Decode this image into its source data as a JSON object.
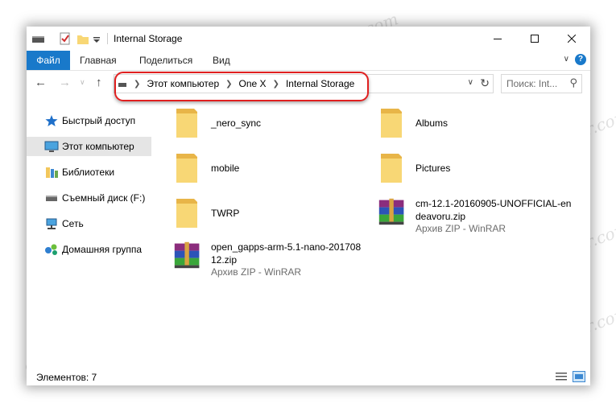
{
  "window": {
    "title": "Internal Storage"
  },
  "ribbon": {
    "tabs": [
      "Файл",
      "Главная",
      "Поделиться",
      "Вид"
    ],
    "help": "?"
  },
  "address": {
    "crumbs": [
      "Этот компьютер",
      "One X",
      "Internal Storage"
    ]
  },
  "search": {
    "placeholder": "Поиск: Int..."
  },
  "nav": {
    "items": [
      {
        "label": "Быстрый доступ",
        "icon": "star-icon"
      },
      {
        "label": "Этот компьютер",
        "icon": "computer-icon",
        "selected": true
      },
      {
        "label": "Библиотеки",
        "icon": "libraries-icon"
      },
      {
        "label": "Съемный диск (F:)",
        "icon": "removable-drive-icon"
      },
      {
        "label": "Сеть",
        "icon": "network-icon"
      },
      {
        "label": "Домашняя группа",
        "icon": "homegroup-icon"
      }
    ]
  },
  "files": [
    {
      "name": "_nero_sync",
      "type": "folder"
    },
    {
      "name": "Albums",
      "type": "folder"
    },
    {
      "name": "mobile",
      "type": "folder"
    },
    {
      "name": "Pictures",
      "type": "folder"
    },
    {
      "name": "TWRP",
      "type": "folder"
    },
    {
      "name_line1": "cm-12.1-20160905-UNOFFICIAL-en",
      "name_line2": "deavoru.zip",
      "sub": "Архив ZIP - WinRAR",
      "type": "archive"
    },
    {
      "name_line1": "open_gapps-arm-5.1-nano-201708",
      "name_line2": "12.zip",
      "sub": "Архив ZIP - WinRAR",
      "type": "archive"
    }
  ],
  "status": {
    "items_count": "Элементов: 7"
  },
  "watermark": "Sovingpcrepair.com",
  "colors": {
    "accent": "#1979ca",
    "highlight_oval": "#e02020",
    "folder": "#f8d775"
  }
}
